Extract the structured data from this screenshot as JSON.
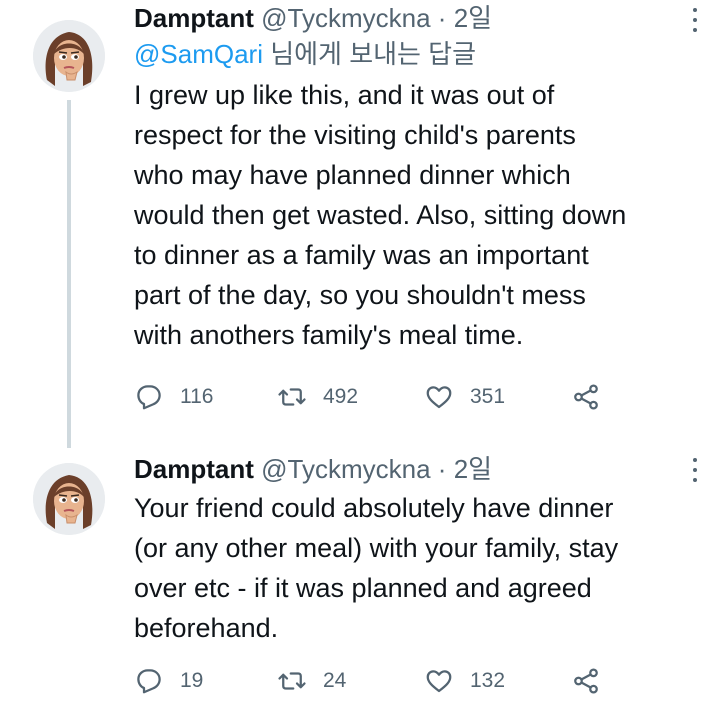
{
  "icons": {
    "reply": "reply-icon",
    "retweet": "retweet-icon",
    "like": "heart-icon",
    "share": "share-icon",
    "more": "more-icon"
  },
  "colors": {
    "text": "#0f1419",
    "secondary": "#536471",
    "link": "#1d9bf0",
    "thread_line": "#cfd9de"
  },
  "tweets": [
    {
      "display_name": "Damptant",
      "handle": "@Tyckmyckna",
      "separator": "·",
      "time": "2일",
      "reply_to_mention": "@SamQari",
      "reply_to_suffix": "님에게 보내는 답글",
      "text": "I grew up like this, and it was out of\nrespect for the visiting child's parents\nwho may have planned dinner which\nwould then get wasted. Also, sitting down\nto dinner as a family was an important\npart of the day, so you shouldn't mess\nwith anothers family's meal time.",
      "reply_count": "116",
      "retweet_count": "492",
      "like_count": "351"
    },
    {
      "display_name": "Damptant",
      "handle": "@Tyckmyckna",
      "separator": "·",
      "time": "2일",
      "text": "Your friend could absolutely have dinner\n(or any other meal) with your family, stay\nover etc - if it was planned and agreed\nbeforehand.",
      "reply_count": "19",
      "retweet_count": "24",
      "like_count": "132"
    }
  ]
}
